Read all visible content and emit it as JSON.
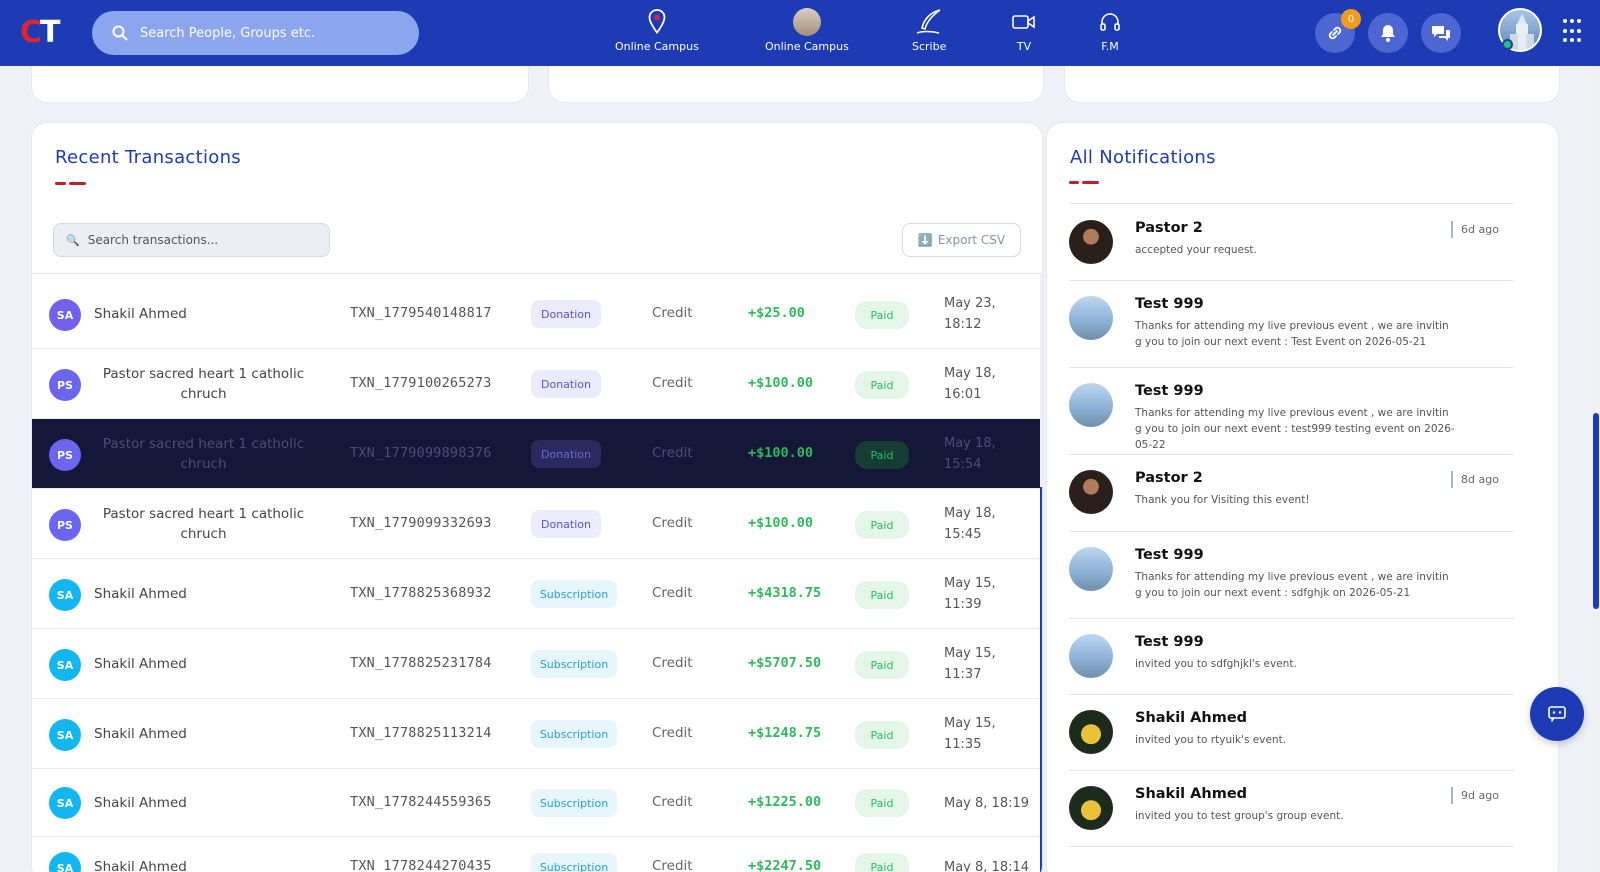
{
  "header": {
    "logo_c": "C",
    "logo_t": "T",
    "search_placeholder": "Search People, Groups etc.",
    "nav": [
      {
        "label": "Online Campus",
        "icon": "location-pin-icon"
      },
      {
        "label": "Online Campus",
        "icon": "campus-photo-icon"
      },
      {
        "label": "Scribe",
        "icon": "quill-icon"
      },
      {
        "label": "TV",
        "icon": "video-camera-icon"
      },
      {
        "label": "F.M",
        "icon": "headphones-icon"
      }
    ],
    "link_badge": "0",
    "brand_color": "#1d3bb5"
  },
  "transactions": {
    "title": "Recent Transactions",
    "search_placeholder": "Search transactions...",
    "search_icon": "🔍",
    "export_icon": "⬇️",
    "export_label": "Export CSV",
    "rows": [
      {
        "initials": "SA",
        "name": "Shakil Ahmed",
        "txn": "TXN_1779540148817",
        "type": "Donation",
        "direction": "Credit",
        "amount": "+$25.00",
        "status": "Paid",
        "date": "May 23, 18:12"
      },
      {
        "initials": "PS",
        "name": "Pastor sacred heart 1 catholic chruch",
        "txn": "TXN_1779100265273",
        "type": "Donation",
        "direction": "Credit",
        "amount": "+$100.00",
        "status": "Paid",
        "date": "May 18, 16:01"
      },
      {
        "initials": "PS",
        "name": "Pastor sacred heart 1 catholic chruch",
        "txn": "TXN_1779099898376",
        "type": "Donation",
        "direction": "Credit",
        "amount": "+$100.00",
        "status": "Paid",
        "date": "May 18, 15:54"
      },
      {
        "initials": "PS",
        "name": "Pastor sacred heart 1 catholic chruch",
        "txn": "TXN_1779099332693",
        "type": "Donation",
        "direction": "Credit",
        "amount": "+$100.00",
        "status": "Paid",
        "date": "May 18, 15:45"
      },
      {
        "initials": "SA",
        "name": "Shakil Ahmed",
        "txn": "TXN_1778825368932",
        "type": "Subscription",
        "direction": "Credit",
        "amount": "+$4318.75",
        "status": "Paid",
        "date": "May 15, 11:39"
      },
      {
        "initials": "SA",
        "name": "Shakil Ahmed",
        "txn": "TXN_1778825231784",
        "type": "Subscription",
        "direction": "Credit",
        "amount": "+$5707.50",
        "status": "Paid",
        "date": "May 15, 11:37"
      },
      {
        "initials": "SA",
        "name": "Shakil Ahmed",
        "txn": "TXN_1778825113214",
        "type": "Subscription",
        "direction": "Credit",
        "amount": "+$1248.75",
        "status": "Paid",
        "date": "May 15, 11:35"
      },
      {
        "initials": "SA",
        "name": "Shakil Ahmed",
        "txn": "TXN_1778244559365",
        "type": "Subscription",
        "direction": "Credit",
        "amount": "+$1225.00",
        "status": "Paid",
        "date": "May 8, 18:19"
      },
      {
        "initials": "SA",
        "name": "Shakil Ahmed",
        "txn": "TXN_1778244270435",
        "type": "Subscription",
        "direction": "Credit",
        "amount": "+$2247.50",
        "status": "Paid",
        "date": "May 8, 18:14"
      }
    ]
  },
  "notifications": {
    "title": "All Notifications",
    "items": [
      {
        "name": "Pastor 2",
        "text": "accepted your request.",
        "time": "6d ago",
        "avatar": "pastor"
      },
      {
        "name": "Test 999",
        "text": "Thanks for attending my live previous event , we are inviting you to join our next event : Test Event on 2026-05-21",
        "time": "",
        "avatar": "church"
      },
      {
        "name": "Test 999",
        "text": "Thanks for attending my live previous event , we are inviting you to join our next event : test999 testing event on 2026-05-22",
        "time": "",
        "avatar": "church"
      },
      {
        "name": "Pastor 2",
        "text": "Thank you for Visiting this event!",
        "time": "8d ago",
        "avatar": "pastor"
      },
      {
        "name": "Test 999",
        "text": "Thanks for attending my live previous event , we are inviting you to join our next event : sdfghjk on 2026-05-21",
        "time": "",
        "avatar": "church"
      },
      {
        "name": "Test 999",
        "text": "invited you to sdfghjkl's event.",
        "time": "",
        "avatar": "church"
      },
      {
        "name": "Shakil Ahmed",
        "text": "invited you to rtyuik's event.",
        "time": "",
        "avatar": "pika"
      },
      {
        "name": "Shakil Ahmed",
        "text": "invited you to test group's group event.",
        "time": "9d ago",
        "avatar": "pika"
      }
    ]
  }
}
